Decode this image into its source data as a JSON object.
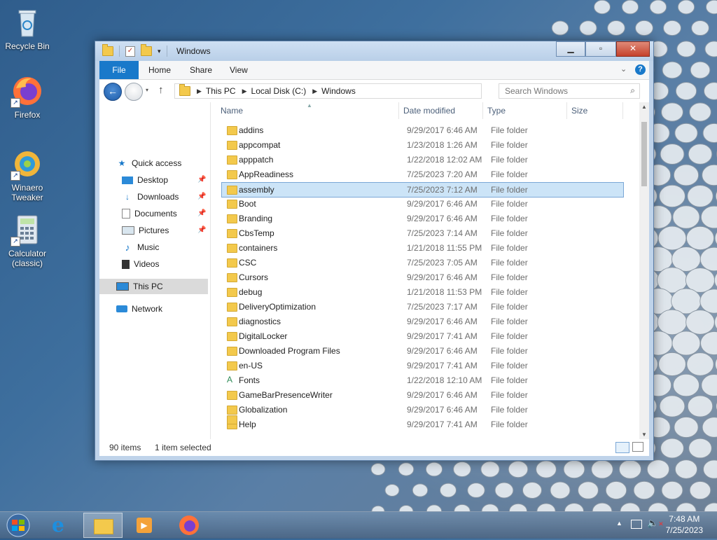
{
  "desktop": {
    "icons": [
      {
        "label": "Recycle Bin"
      },
      {
        "label": "Firefox"
      },
      {
        "label": "Winaero Tweaker"
      },
      {
        "label": "Calculator (classic)"
      }
    ]
  },
  "window": {
    "title": "Windows",
    "ribbon_tabs": [
      "File",
      "Home",
      "Share",
      "View"
    ],
    "address": {
      "segments": [
        "This PC",
        "Local Disk (C:)",
        "Windows"
      ]
    },
    "search_placeholder": "Search Windows",
    "nav": {
      "quick_access": "Quick access",
      "items": [
        "Desktop",
        "Downloads",
        "Documents",
        "Pictures",
        "Music",
        "Videos"
      ],
      "this_pc": "This PC",
      "network": "Network"
    },
    "columns": [
      "Name",
      "Date modified",
      "Type",
      "Size"
    ],
    "files": [
      {
        "name": "addins",
        "date": "9/29/2017 6:46 AM",
        "type": "File folder"
      },
      {
        "name": "appcompat",
        "date": "1/23/2018 1:26 AM",
        "type": "File folder"
      },
      {
        "name": "apppatch",
        "date": "1/22/2018 12:02 AM",
        "type": "File folder"
      },
      {
        "name": "AppReadiness",
        "date": "7/25/2023 7:20 AM",
        "type": "File folder"
      },
      {
        "name": "assembly",
        "date": "7/25/2023 7:12 AM",
        "type": "File folder"
      },
      {
        "name": "Boot",
        "date": "9/29/2017 6:46 AM",
        "type": "File folder"
      },
      {
        "name": "Branding",
        "date": "9/29/2017 6:46 AM",
        "type": "File folder"
      },
      {
        "name": "CbsTemp",
        "date": "7/25/2023 7:14 AM",
        "type": "File folder"
      },
      {
        "name": "containers",
        "date": "1/21/2018 11:55 PM",
        "type": "File folder"
      },
      {
        "name": "CSC",
        "date": "7/25/2023 7:05 AM",
        "type": "File folder"
      },
      {
        "name": "Cursors",
        "date": "9/29/2017 6:46 AM",
        "type": "File folder"
      },
      {
        "name": "debug",
        "date": "1/21/2018 11:53 PM",
        "type": "File folder"
      },
      {
        "name": "DeliveryOptimization",
        "date": "7/25/2023 7:17 AM",
        "type": "File folder"
      },
      {
        "name": "diagnostics",
        "date": "9/29/2017 6:46 AM",
        "type": "File folder"
      },
      {
        "name": "DigitalLocker",
        "date": "9/29/2017 7:41 AM",
        "type": "File folder"
      },
      {
        "name": "Downloaded Program Files",
        "date": "9/29/2017 6:46 AM",
        "type": "File folder"
      },
      {
        "name": "en-US",
        "date": "9/29/2017 7:41 AM",
        "type": "File folder"
      },
      {
        "name": "Fonts",
        "date": "1/22/2018 12:10 AM",
        "type": "File folder"
      },
      {
        "name": "GameBarPresenceWriter",
        "date": "9/29/2017 6:46 AM",
        "type": "File folder"
      },
      {
        "name": "Globalization",
        "date": "9/29/2017 6:46 AM",
        "type": "File folder"
      },
      {
        "name": "Help",
        "date": "9/29/2017 7:41 AM",
        "type": "File folder"
      }
    ],
    "selected_index": 4,
    "status": {
      "count": "90 items",
      "selected": "1 item selected"
    }
  },
  "taskbar": {
    "time": "7:48 AM",
    "date": "7/25/2023"
  }
}
